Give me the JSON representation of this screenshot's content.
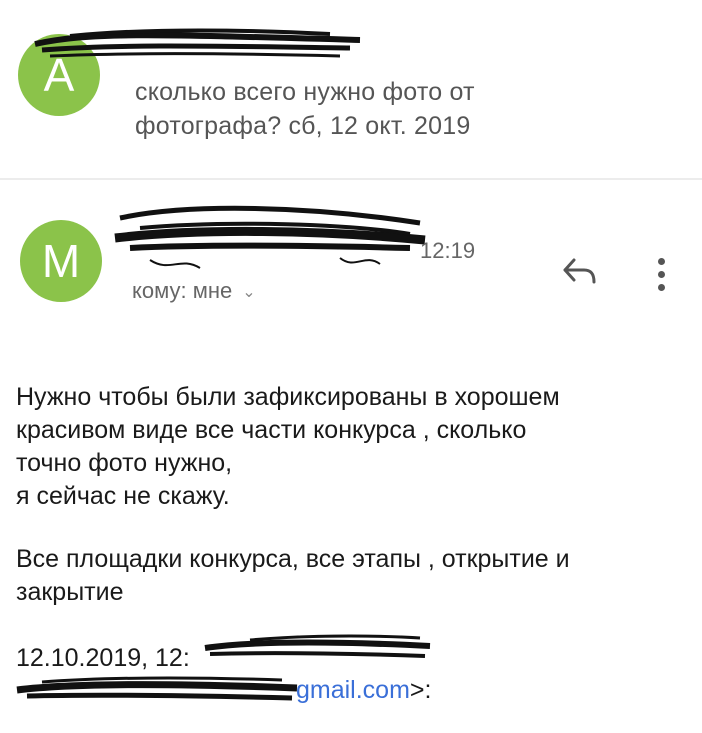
{
  "colors": {
    "avatar_green": "#8BC34A",
    "link_blue": "#3a6fd8",
    "redaction": "#111111"
  },
  "thread_preview": {
    "avatar_letter": "A",
    "line1": "сколько всего нужно фото от",
    "line2": "фотографа? сб, 12 окт. 2019"
  },
  "message": {
    "avatar_letter": "M",
    "time": "12:19",
    "to_label": "кому: мне",
    "reply_icon": "reply-icon",
    "more_icon": "more-vert-icon",
    "body": {
      "p1_l1": "Нужно чтобы были зафиксированы в хорошем",
      "p1_l2": "красивом виде все части конкурса , сколько",
      "p1_l3": "точно фото нужно,",
      "p1_l4": "я сейчас не скажу.",
      "p2_l1": "Все площадки конкурса, все этапы , открытие и",
      "p2_l2": "закрытие"
    },
    "quote": {
      "date_prefix": "12.10.2019, 12:",
      "email_visible": "gmail.com",
      "email_tail": ">:"
    }
  }
}
